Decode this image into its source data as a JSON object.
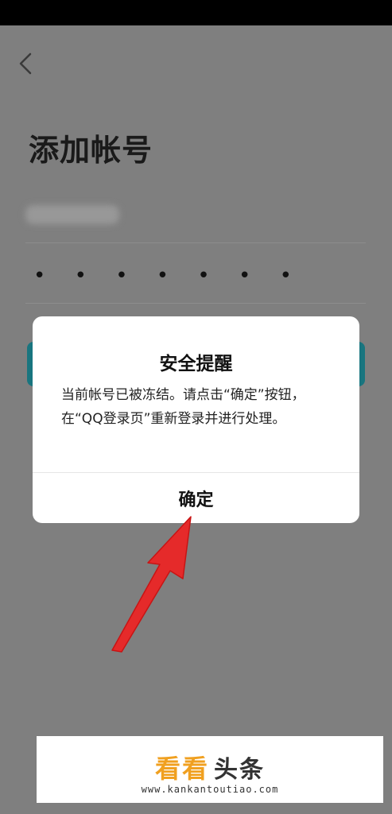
{
  "page": {
    "title": "添加帐号",
    "password_mask": "• • • • • • •"
  },
  "dialog": {
    "title": "安全提醒",
    "message": "当前帐号已被冻结。请点击“确定”按钮，在“QQ登录页”重新登录并进行处理。",
    "confirm_label": "确定"
  },
  "watermark": {
    "logo_primary": "看看",
    "logo_secondary": "头条",
    "url": "www.kankantoutiao.com"
  },
  "icons": {
    "back": "chevron-left-icon",
    "annotation": "red-arrow-icon"
  },
  "colors": {
    "overlay": "#7f7f7f",
    "accent": "#19757f",
    "arrow": "#e52a2a",
    "logo": "#f0a020"
  }
}
